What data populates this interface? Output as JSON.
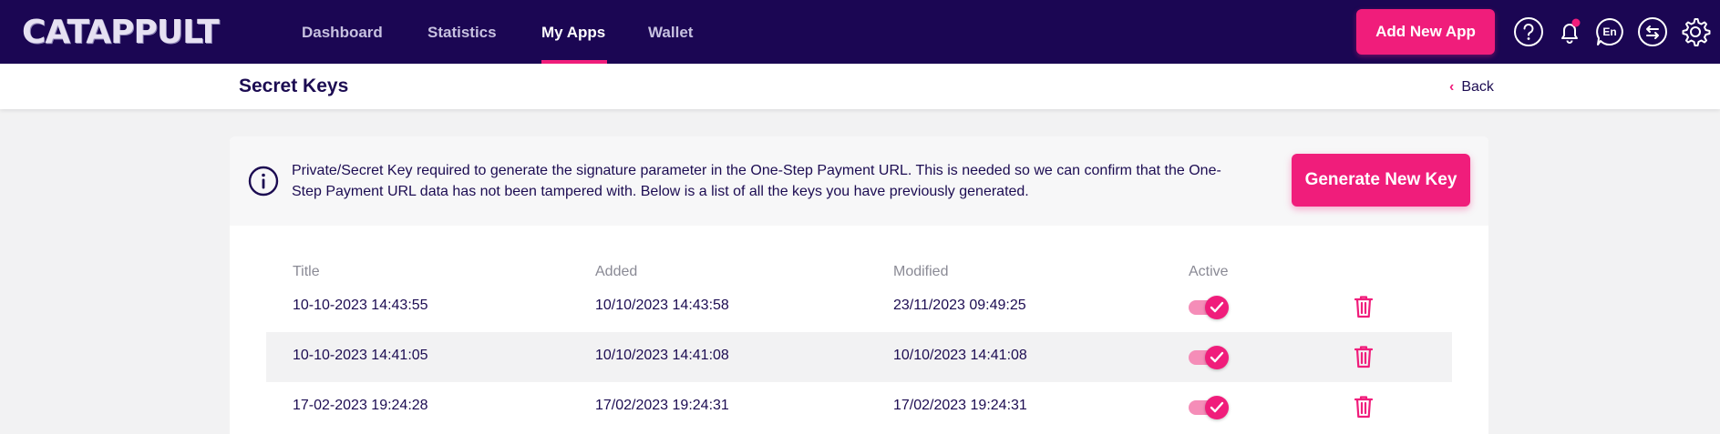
{
  "app": {
    "logo_text": "CATAPPULT"
  },
  "nav": {
    "links": [
      {
        "label": "Dashboard"
      },
      {
        "label": "Statistics"
      },
      {
        "label": "My Apps"
      },
      {
        "label": "Wallet"
      }
    ],
    "active": "My Apps",
    "add_app_label": "Add New App",
    "language_label": "En"
  },
  "subheader": {
    "title": "Secret Keys",
    "back_label": "Back"
  },
  "info": {
    "text": "Private/Secret Key required to generate the signature parameter in the One-Step Payment URL. This is needed so we can confirm that the One-Step Payment URL data has not been tampered with. Below is a list of all the keys you have previously generated.",
    "generate_label": "Generate New Key"
  },
  "table": {
    "headers": {
      "title": "Title",
      "added": "Added",
      "modified": "Modified",
      "active": "Active"
    },
    "rows": [
      {
        "title": "10-10-2023 14:43:55",
        "added": "10/10/2023 14:43:58",
        "modified": "23/11/2023 09:49:25",
        "active": true
      },
      {
        "title": "10-10-2023 14:41:05",
        "added": "10/10/2023 14:41:08",
        "modified": "10/10/2023 14:41:08",
        "active": true
      },
      {
        "title": "17-02-2023 19:24:28",
        "added": "17/02/2023 19:24:31",
        "modified": "17/02/2023 19:24:31",
        "active": true
      }
    ]
  },
  "colors": {
    "nav_bg": "#1b0653",
    "accent": "#f01d7b",
    "text": "#1c0c52",
    "page_bg": "#f2f2f3"
  },
  "icons": [
    "help-icon",
    "bell-icon",
    "language-icon",
    "switch-account-icon",
    "settings-icon",
    "info-icon",
    "chevron-left-icon",
    "check-icon",
    "trash-icon"
  ]
}
